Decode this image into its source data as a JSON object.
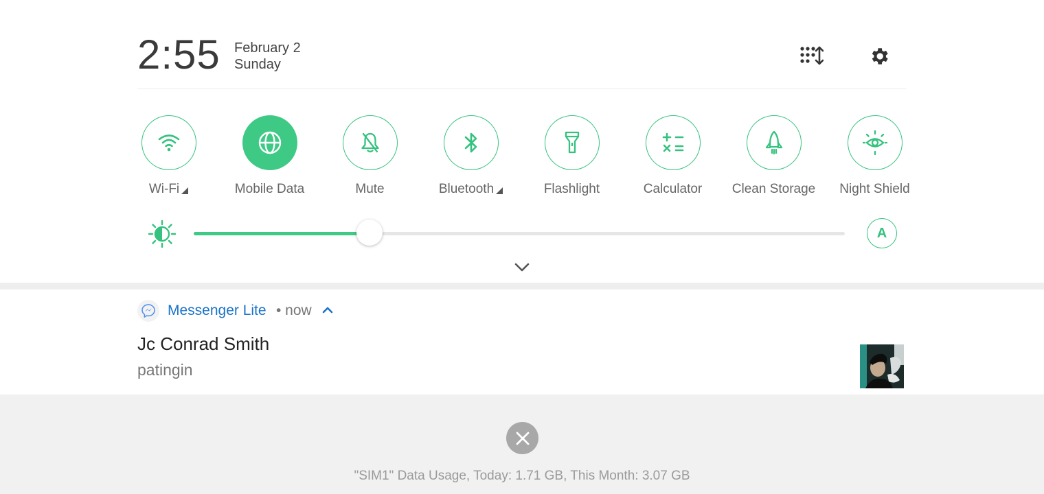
{
  "header": {
    "time": "2:55",
    "date": "February 2",
    "day": "Sunday"
  },
  "toggles": [
    {
      "label": "Wi-Fi",
      "icon": "wifi-icon",
      "active": false,
      "has_menu": true
    },
    {
      "label": "Mobile Data",
      "icon": "globe-icon",
      "active": true,
      "has_menu": false
    },
    {
      "label": "Mute",
      "icon": "bell-off-icon",
      "active": false,
      "has_menu": false
    },
    {
      "label": "Bluetooth",
      "icon": "bluetooth-icon",
      "active": false,
      "has_menu": true
    },
    {
      "label": "Flashlight",
      "icon": "flashlight-icon",
      "active": false,
      "has_menu": false
    },
    {
      "label": "Calculator",
      "icon": "calculator-icon",
      "active": false,
      "has_menu": false
    },
    {
      "label": "Clean Storage",
      "icon": "rocket-icon",
      "active": false,
      "has_menu": false
    },
    {
      "label": "Night Shield",
      "icon": "eye-sun-icon",
      "active": false,
      "has_menu": false
    }
  ],
  "brightness": {
    "level_fraction": 0.27,
    "auto_label": "A"
  },
  "notification": {
    "app_name": "Messenger Lite",
    "time": "• now",
    "title": "Jc Conrad Smith",
    "message": "patingin"
  },
  "footer": {
    "usage_text": "\"SIM1\" Data Usage, Today: 1.71 GB, This Month: 3.07 GB"
  },
  "colors": {
    "accent": "#3ec985",
    "link": "#1a73c9"
  }
}
